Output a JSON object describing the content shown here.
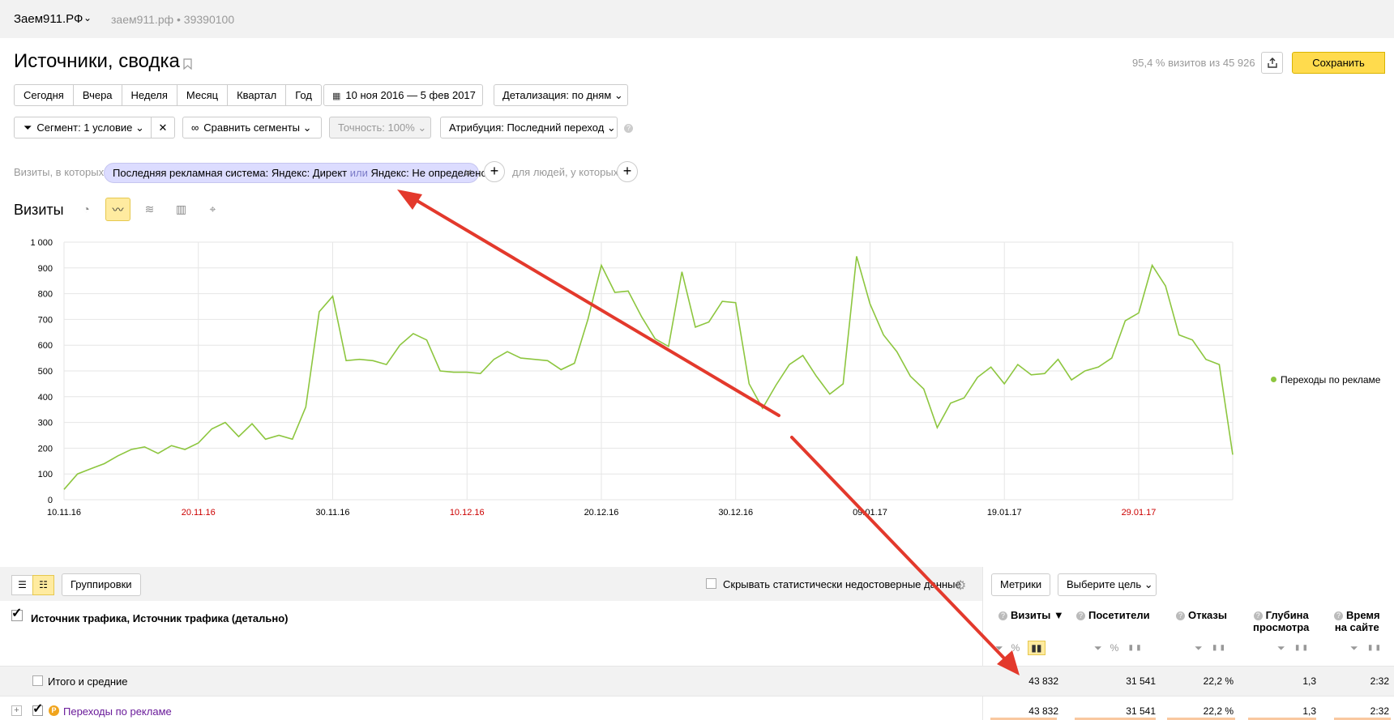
{
  "topbar": {
    "site_name": "Заем911.РФ",
    "site_sub": "заем911.рф  •  39390100"
  },
  "page": {
    "title": "Источники, сводка",
    "visits_info": "95,4 % визитов из 45 926",
    "save_label": "Сохранить"
  },
  "periods": [
    "Сегодня",
    "Вчера",
    "Неделя",
    "Месяц",
    "Квартал",
    "Год"
  ],
  "date_range": "10 ноя 2016 — 5 фев 2017",
  "detail": "Детализация: по дням",
  "segment": "Сегмент: 1 условие",
  "compare": "Сравнить сегменты",
  "accuracy": "Точность: 100%",
  "attribution": "Атрибуция: Последний переход",
  "filter": {
    "prefix": "Визиты, в которых",
    "chip_part1": "Последняя рекламная система: Яндекс: Директ ",
    "chip_or": "или",
    "chip_part2": " Яндекс: Не определено",
    "people": "для людей, у которых"
  },
  "chart_title": "Визиты",
  "colors": {
    "line": "#8dc63f",
    "accent": "#ffdb4d",
    "arrow": "#e3392c",
    "holiday": "#cc0000"
  },
  "chart_data": {
    "type": "line",
    "y_ticks": [
      "1 000",
      "900",
      "800",
      "700",
      "600",
      "500",
      "400",
      "300",
      "200",
      "100",
      "0"
    ],
    "ylim": [
      0,
      1000
    ],
    "x_ticks": [
      "10.11.16",
      "20.11.16",
      "30.11.16",
      "10.12.16",
      "20.12.16",
      "30.12.16",
      "09.01.17",
      "19.01.17",
      "29.01.17"
    ],
    "x_tick_holiday": [
      false,
      true,
      false,
      true,
      false,
      false,
      false,
      false,
      true
    ],
    "series": [
      {
        "name": "Переходы по рекламе",
        "values": [
          40,
          100,
          120,
          140,
          170,
          195,
          205,
          180,
          210,
          195,
          220,
          275,
          300,
          245,
          295,
          235,
          250,
          235,
          360,
          730,
          790,
          540,
          545,
          540,
          525,
          600,
          645,
          620,
          500,
          495,
          495,
          490,
          545,
          575,
          550,
          545,
          540,
          505,
          530,
          700,
          910,
          805,
          810,
          710,
          625,
          595,
          885,
          670,
          690,
          770,
          765,
          450,
          355,
          445,
          525,
          560,
          480,
          410,
          450,
          945,
          760,
          640,
          575,
          480,
          430,
          280,
          375,
          395,
          475,
          515,
          450,
          525,
          485,
          490,
          545,
          465,
          500,
          515,
          550,
          695,
          725,
          910,
          830,
          640,
          620,
          545,
          525,
          175
        ]
      }
    ]
  },
  "table": {
    "group_btn": "Группировки",
    "hide_label": "Скрывать статистически недостоверные данные",
    "metrics_btn": "Метрики",
    "goal_btn": "Выберите цель",
    "dim_header": "Источник трафика, Источник трафика (детально)",
    "columns": [
      "Визиты ▼",
      "Посетители",
      "Отказы",
      "Глубина просмотра",
      "Время на сайте"
    ],
    "col_depth_1": "Глубина",
    "col_depth_2": "просмотра",
    "col_time_1": "Время",
    "col_time_2": "на сайте",
    "total_label": "Итого и средние",
    "totals": [
      "43 832",
      "31 541",
      "22,2 %",
      "1,3",
      "2:32"
    ],
    "row_label": "Переходы по рекламе",
    "row_values": [
      "43 832",
      "31 541",
      "22,2 %",
      "1,3",
      "2:32"
    ]
  }
}
